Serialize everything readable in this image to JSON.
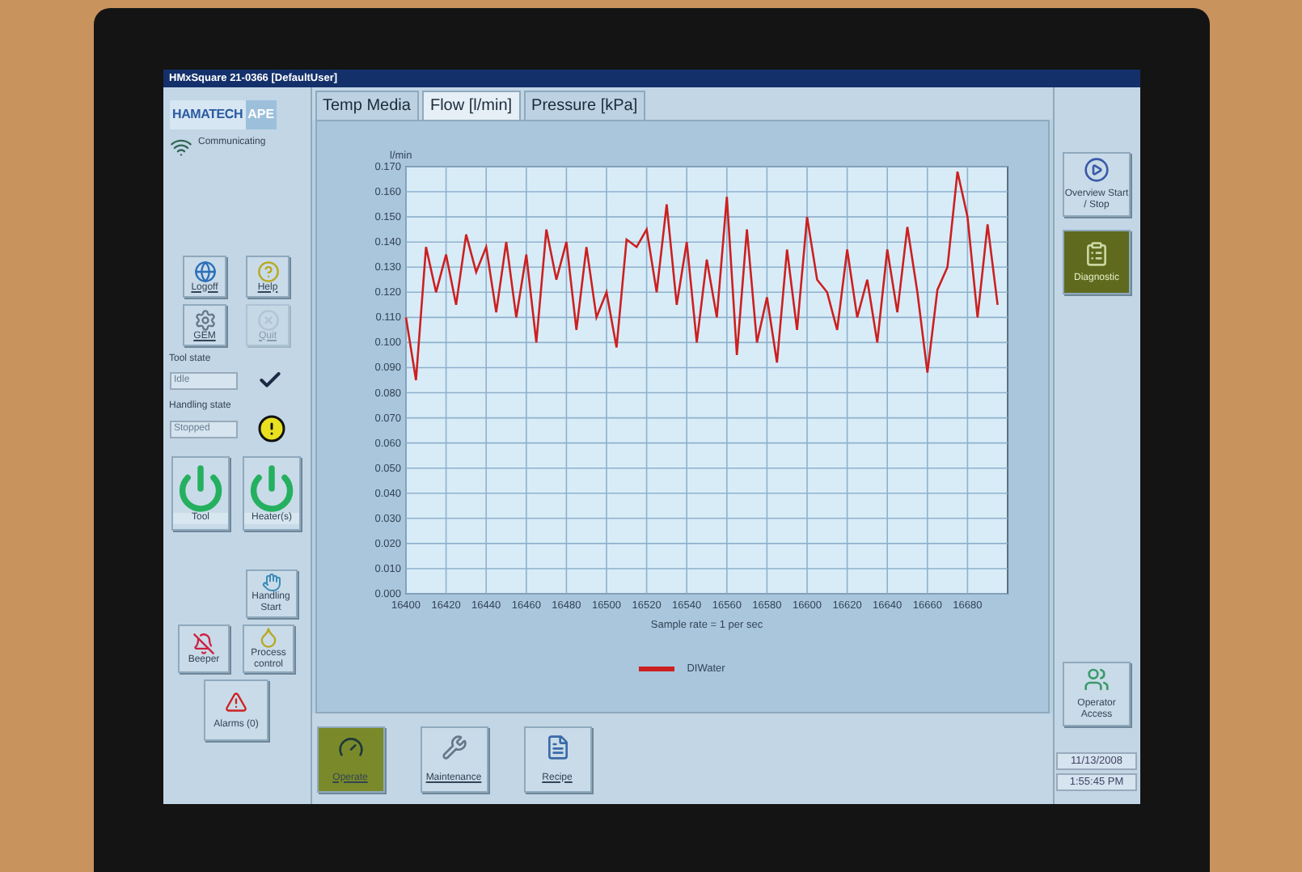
{
  "window": {
    "title": "HMxSquare 21-0366 [DefaultUser]"
  },
  "left_panel": {
    "logo": {
      "main": "HAMATECH",
      "suffix": "APE"
    },
    "status": "Communicating",
    "top_buttons": [
      {
        "label": "Logoff",
        "disabled": false
      },
      {
        "label": "Help",
        "disabled": false
      },
      {
        "label": "GEM",
        "disabled": false
      },
      {
        "label": "Quit",
        "disabled": true
      }
    ],
    "states": [
      {
        "label": "Tool state",
        "value": "Idle"
      },
      {
        "label": "Handling state",
        "value": "Stopped"
      }
    ],
    "power_buttons": [
      {
        "label": "Tool",
        "on": true
      },
      {
        "label": "Heater(s)",
        "on": true
      }
    ],
    "handling_button": {
      "label": "Handling Start"
    },
    "bottom_buttons": [
      {
        "label": "Beeper"
      },
      {
        "label": "Process control"
      }
    ],
    "alarms_button": {
      "label": "Alarms (0)"
    }
  },
  "tabs": [
    {
      "label": "Temp Media",
      "selected": false
    },
    {
      "label": "Flow [l/min]",
      "selected": true
    },
    {
      "label": "Pressure [kPa]",
      "selected": false
    }
  ],
  "chart": {
    "chart_data": {
      "type": "line",
      "grid": true,
      "xlabel": "Sample rate = 1 per sec",
      "ylabel": "l/min",
      "x": [
        16400,
        16405,
        16410,
        16415,
        16420,
        16425,
        16430,
        16435,
        16440,
        16445,
        16450,
        16455,
        16460,
        16465,
        16470,
        16475,
        16480,
        16485,
        16490,
        16495,
        16500,
        16505,
        16510,
        16515,
        16520,
        16525,
        16530,
        16535,
        16540,
        16545,
        16550,
        16555,
        16560,
        16565,
        16570,
        16575,
        16580,
        16585,
        16590,
        16595,
        16600,
        16605,
        16610,
        16615,
        16620,
        16625,
        16630,
        16635,
        16640,
        16645,
        16650,
        16655,
        16660,
        16665,
        16670,
        16675,
        16680,
        16685,
        16690,
        16695
      ],
      "series": [
        {
          "name": "DIWater",
          "color": "#cc2020",
          "values": [
            0.11,
            0.085,
            0.138,
            0.12,
            0.135,
            0.115,
            0.143,
            0.128,
            0.138,
            0.112,
            0.14,
            0.11,
            0.135,
            0.1,
            0.145,
            0.125,
            0.14,
            0.105,
            0.138,
            0.11,
            0.12,
            0.098,
            0.141,
            0.138,
            0.145,
            0.12,
            0.155,
            0.115,
            0.14,
            0.1,
            0.133,
            0.11,
            0.158,
            0.095,
            0.145,
            0.1,
            0.118,
            0.092,
            0.137,
            0.105,
            0.15,
            0.125,
            0.12,
            0.105,
            0.137,
            0.11,
            0.125,
            0.1,
            0.137,
            0.112,
            0.146,
            0.12,
            0.088,
            0.121,
            0.13,
            0.168,
            0.15,
            0.11,
            0.147,
            0.115
          ]
        }
      ],
      "xlim": [
        16400,
        16700
      ],
      "ylim": [
        0,
        0.17
      ],
      "xticks": [
        16400,
        16420,
        16440,
        16460,
        16480,
        16500,
        16520,
        16540,
        16560,
        16580,
        16600,
        16620,
        16640,
        16660,
        16680
      ],
      "yticks": [
        {
          "value": 0,
          "label": "0.000"
        },
        {
          "value": 0.01,
          "label": "0.010"
        },
        {
          "value": 0.02,
          "label": "0.020"
        },
        {
          "value": 0.03,
          "label": "0.030"
        },
        {
          "value": 0.04,
          "label": "0.040"
        },
        {
          "value": 0.05,
          "label": "0.050"
        },
        {
          "value": 0.06,
          "label": "0.060"
        },
        {
          "value": 0.07,
          "label": "0.070"
        },
        {
          "value": 0.08,
          "label": "0.080"
        },
        {
          "value": 0.09,
          "label": "0.090"
        },
        {
          "value": 0.1,
          "label": "0.100"
        },
        {
          "value": 0.11,
          "label": "0.110"
        },
        {
          "value": 0.12,
          "label": "0.120"
        },
        {
          "value": 0.13,
          "label": "0.130"
        },
        {
          "value": 0.14,
          "label": "0.140"
        },
        {
          "value": 0.15,
          "label": "0.150"
        },
        {
          "value": 0.16,
          "label": "0.160"
        },
        {
          "value": 0.17,
          "label": "0.170"
        }
      ]
    }
  },
  "toolbar": [
    {
      "label": "Operate",
      "selected": true
    },
    {
      "label": "Maintenance",
      "selected": false
    },
    {
      "label": "Recipe",
      "selected": false
    }
  ],
  "right_panel": {
    "buttons": [
      {
        "label": "Overview Start / Stop",
        "selected": false
      },
      {
        "label": "Diagnostic",
        "selected": true
      }
    ],
    "access_button": {
      "label": "Operator Access"
    },
    "date": "11/13/2008",
    "time": "1:55:45 PM"
  }
}
